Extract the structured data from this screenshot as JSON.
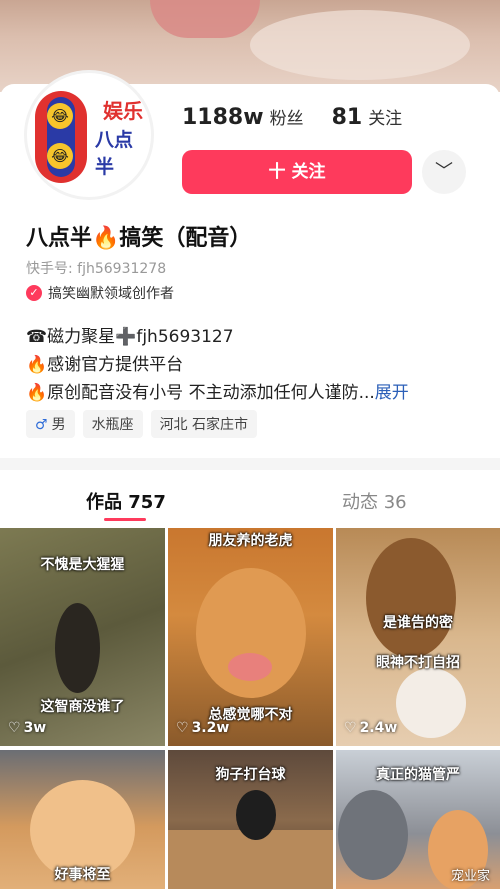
{
  "profile": {
    "avatar": {
      "line1": "娱乐",
      "line2": "八点半"
    },
    "followers_count": "1188w",
    "followers_label": "粉丝",
    "following_count": "81",
    "following_label": "关注",
    "follow_button": "十 关注",
    "more_icon": "chevron-down-icon",
    "name": "八点半🔥搞笑（配音）",
    "uid": "快手号: fjh56931278",
    "creator_badge": "搞笑幽默领域创作者",
    "bio": [
      "☎磁力聚星➕fjh5693127",
      "🔥感谢官方提供平台",
      "🔥原创配音没有小号 不主动添加任何人谨防..."
    ],
    "bio_more": "展开",
    "tags": {
      "gender_icon": "♂",
      "gender": "男",
      "zodiac": "水瓶座",
      "location": "河北 石家庄市"
    }
  },
  "tabs": {
    "works": "作品 757",
    "dynamics": "动态 36"
  },
  "videos": [
    {
      "caption_top": "不愧是大猩猩",
      "caption_bottom": "这智商没谁了",
      "likes": "3w"
    },
    {
      "caption_top": "朋友养的老虎",
      "caption_bottom": "总感觉哪不对",
      "likes": "3.2w"
    },
    {
      "caption_top": "是谁告的密",
      "caption_bottom": "眼神不打自招",
      "likes": "2.4w"
    },
    {
      "caption_top": "",
      "caption_bottom": "好事将至",
      "likes": ""
    },
    {
      "caption_top": "狗子打台球",
      "caption_bottom": "",
      "likes": ""
    },
    {
      "caption_top": "真正的猫管严",
      "caption_bottom": "",
      "likes": ""
    }
  ],
  "watermark": "宠业家",
  "colors": {
    "accent": "#fe3a5c",
    "link": "#2b5fb8"
  }
}
